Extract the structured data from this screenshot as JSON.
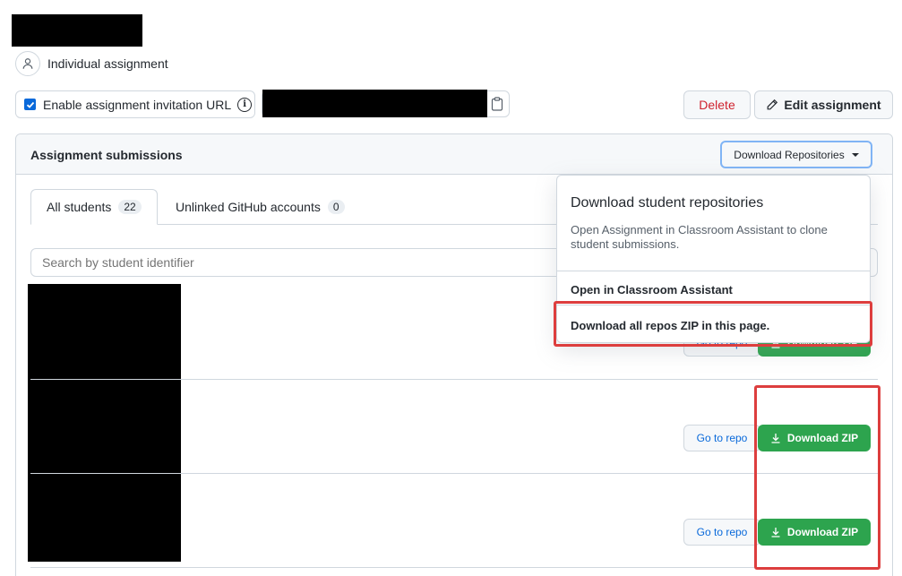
{
  "assignment": {
    "type_label": "Individual assignment",
    "invite_checkbox_label": "Enable assignment invitation URL",
    "invite_enabled": true
  },
  "toolbar": {
    "delete_label": "Delete",
    "edit_label": "Edit assignment"
  },
  "submissions": {
    "title": "Assignment submissions",
    "download_repos_label": "Download Repositories",
    "tabs": [
      {
        "label": "All students",
        "count": "22"
      },
      {
        "label": "Unlinked GitHub accounts",
        "count": "0"
      }
    ],
    "search_placeholder": "Search by student identifier",
    "rows": [
      {
        "go_label": "Go to repo",
        "zip_label": "Download ZIP"
      },
      {
        "go_label": "Go to repo",
        "zip_label": "Download ZIP"
      },
      {
        "go_label": "Go to repo",
        "zip_label": "Download ZIP"
      }
    ]
  },
  "dropdown": {
    "title": "Download student repositories",
    "description": "Open Assignment in Classroom Assistant to clone student submissions.",
    "items": [
      {
        "label": "Open in Classroom Assistant"
      },
      {
        "label": "Download all repos ZIP in this page."
      }
    ]
  },
  "colors": {
    "accent_blue": "#0969da",
    "success_green": "#2da44e",
    "danger_red": "#cf222e",
    "highlight_red": "#dd3e3e"
  },
  "icons": [
    "person-icon",
    "info-icon",
    "clipboard-icon",
    "pencil-icon",
    "caret-down-icon",
    "download-icon"
  ]
}
